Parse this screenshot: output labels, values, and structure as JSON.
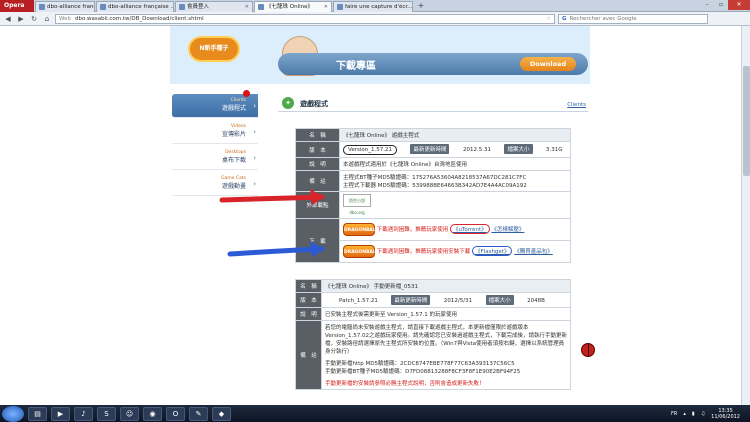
{
  "browser": {
    "app_name": "Opera",
    "tabs": [
      {
        "label": "dbo-alliance française ...",
        "active": false
      },
      {
        "label": "dbo-alliance française ...",
        "active": false
      },
      {
        "label": "會員登入",
        "active": false
      },
      {
        "label": "《七龍珠 Online》",
        "active": true
      },
      {
        "label": "faire une capture d'écr...",
        "active": false
      }
    ],
    "address": {
      "prefix": "Web",
      "url": "dbo.wasabii.com.tw/DB_Download/client.shtml"
    },
    "search_placeholder": "Rechercher avec Google"
  },
  "banner": {
    "logo_text": "N新手種子",
    "title": "下載專區",
    "download_button": "Download"
  },
  "sidebar": {
    "items": [
      {
        "en": "Clients",
        "zh": "遊戲程式",
        "active": true
      },
      {
        "en": "Videos",
        "zh": "宣傳影片",
        "active": false
      },
      {
        "en": "Desktops",
        "zh": "桌布下載",
        "active": false
      },
      {
        "en": "Game Cats",
        "zh": "遊戲動畫",
        "active": false
      }
    ]
  },
  "section": {
    "title": "遊戲程式",
    "title_en": "Clients"
  },
  "table1": {
    "name_label": "名　稱",
    "name_value": "《七龍珠 Online》 遊戲主程式",
    "version_label": "版　本",
    "version_value": "Version_1.57.21",
    "update_label": "最新更新時間",
    "update_value": "2012.5.31",
    "size_label": "檔案大小",
    "size_value": "3.31G",
    "desc_label": "說　明",
    "desc_value": "本遊戲程式適用於《七龍珠 Online》台灣地區使用",
    "note_label": "備　註",
    "note_line1": "主程式BT種子MD5驗證碼：175276A53604A8218537A67DC281C7FC",
    "note_line2": "主程式下載器 MD5驗證碼：539988BE64663B342AD7E4A4AC09A192",
    "external_label": "外部載點",
    "external_logo": "悟空小說 dbo.org",
    "download_label": "下　載",
    "game_logo": "DRAGONBALL",
    "dl_line1_red": "下載遇到困難，推薦玩家使用",
    "dl_line1_link": "《uTorrent》",
    "dl_line1_help": "《怎樣解壓》",
    "dl_line2_red": "下載遇到困難，推薦玩家使用安裝下載",
    "dl_line2_link": "《Flashget》",
    "dl_line2_help": "《購買產品包》"
  },
  "table2": {
    "name_label": "名　稱",
    "name_value": "《七龍珠 Online》 手動更新檔_0531",
    "version_label": "版　本",
    "version_value": "Patch_1.57.21",
    "update_label": "最新更新時間",
    "update_value": "2012/5/31",
    "size_label": "檔案大小",
    "size_value": "2048B",
    "desc_label": "說　明",
    "desc_value": "已安裝主程式後需更新至 Version_1.57.1 的玩家使用",
    "note_label": "備　註",
    "note_para1": "若您的電腦尚未安裝遊戲主程式，請直接下載遊戲主程式，本更新檔僅限於遊戲版本 Version_1.57.02之遊戲玩家使用。請先確認您已安裝過遊戲主程式，下載完成後，請執行手動更新檔，安裝路徑請選擇原先主程式所安裝的位置。（Win7與Vista使用者須按右鍵，選擇以系統管理員身分執行）",
    "note_para2a": "手動更新檔http MD5驗證碼：2CDC8747EBE778F77C63A393137C56C5",
    "note_para2b": "手動更新檔BT種子MD5驗證碼：D7FD08813288F8CF3F8F1E90E2BF94F25",
    "note_para3": "手動更新檔的安裝請參照必勝主程式說明，否則會造成更新失敗！"
  },
  "taskbar": {
    "icons": [
      "folder-icon",
      "media-icon",
      "media-player-icon",
      "skype-icon",
      "messenger-icon",
      "firefox-icon",
      "opera-icon",
      "notepad-icon",
      "game-icon"
    ],
    "lang": "FR",
    "time": "13:35",
    "date": "11/06/2012"
  },
  "colors": {
    "accent_blue": "#3d6ea5",
    "arrow_red": "#d9232a",
    "arrow_blue": "#2b5ad4"
  }
}
